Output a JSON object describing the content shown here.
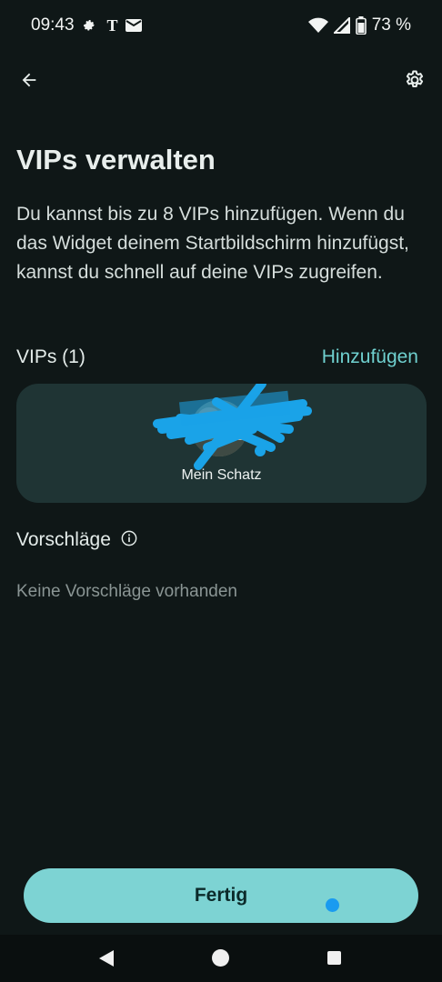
{
  "status_bar": {
    "time": "09:43",
    "carrier_icon_text": "T",
    "battery_percent": "73 %",
    "icons": [
      "settings-gear-icon",
      "carrier-t-icon",
      "mail-icon",
      "wifi-icon",
      "cell-signal-icon",
      "battery-icon"
    ]
  },
  "topbar": {
    "back_icon": "arrow-left-icon",
    "settings_icon": "gear-icon"
  },
  "page": {
    "title": "VIPs verwalten",
    "description": "Du kannst bis zu 8 VIPs hinzufügen. Wenn du das Widget deinem Startbildschirm hinzufügst, kannst du schnell auf deine VIPs zugreifen."
  },
  "vips": {
    "label": "VIPs (1)",
    "add_label": "Hinzufügen",
    "items": [
      {
        "name": "Mein Schatz"
      }
    ]
  },
  "suggestions": {
    "title": "Vorschläge",
    "info_icon": "info-icon",
    "empty_text": "Keine Vorschläge vorhanden"
  },
  "footer": {
    "done_label": "Fertig"
  },
  "colors": {
    "background": "#0f1717",
    "accent": "#6fd0cf",
    "card": "#1f3434",
    "button": "#7dd3d3",
    "scribble": "#1aa3e8"
  }
}
